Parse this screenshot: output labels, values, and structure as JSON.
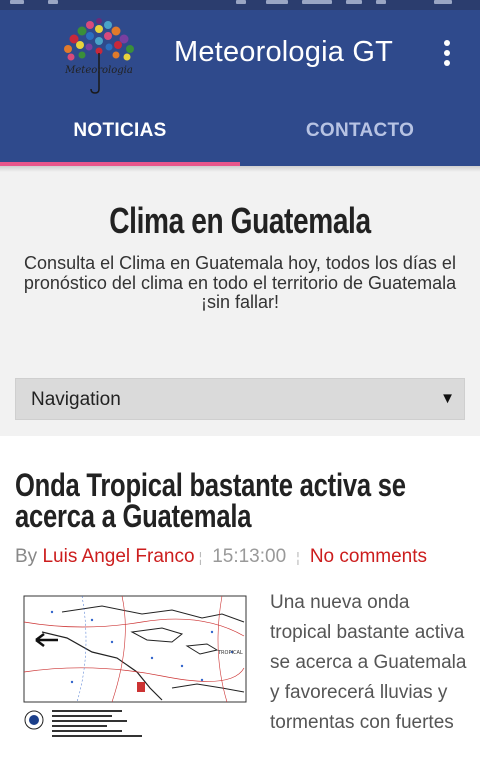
{
  "app": {
    "title": "Meteorologia GT",
    "logo_text": "Meteorologia"
  },
  "tabs": [
    {
      "label": "NOTICIAS",
      "active": true
    },
    {
      "label": "CONTACTO",
      "active": false
    }
  ],
  "intro": {
    "title": "Clima en Guatemala",
    "description": "Consulta el Clima en Guatemala hoy, todos los días el pronóstico del clima en todo el territorio de Guatemala ¡sin fallar!"
  },
  "navigation": {
    "selected": "Navigation",
    "arrow": "▼"
  },
  "post": {
    "title": "Onda Tropical bastante activa se acerca a Guatemala",
    "by_label": "By",
    "author": "Luis Angel Franco",
    "time": "15:13:00",
    "comments": "No comments",
    "excerpt": "Una nueva onda tropical bastante activa se acerca a Guatemala y favorecerá lluvias y tormentas con fuertes",
    "image_icon": "surface-analysis-map"
  },
  "colors": {
    "appbar": "#2f4a8c",
    "tab_indicator": "#e8568b",
    "link": "#cc1d1d"
  }
}
